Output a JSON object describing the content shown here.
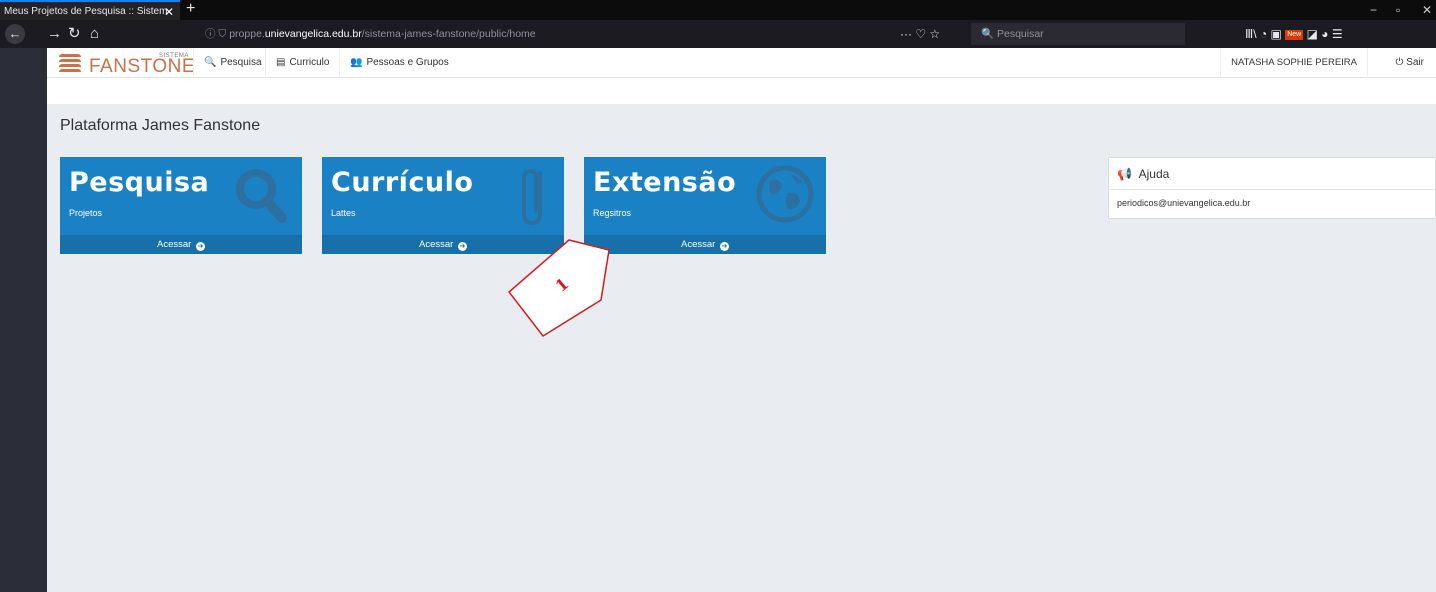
{
  "browser": {
    "tab_title": "Meus Projetos de Pesquisa :: Sistem",
    "tab_close": "✕",
    "new_tab": "+",
    "url_prefix": "ⓘ ⛉  proppe.",
    "url_host": "unievangelica.edu.br",
    "url_path": "/sistema-james-fanstone/public/home",
    "url_actions": "··· ♡ ☆",
    "search_placeholder": "🔍  Pesquisar",
    "toolbar_icons": "Ⅲ\\  ◔   ▣",
    "new_badge": "New",
    "window_minimize": "−",
    "window_restore": "▫",
    "window_close": "✕"
  },
  "header": {
    "logo_sup": "SISTEMA",
    "logo_text": "FANSTONE",
    "menu": [
      {
        "icon": "🔍",
        "label": "Pesquisa"
      },
      {
        "icon": "▤",
        "label": "Curriculo"
      },
      {
        "icon": "👥",
        "label": "Pessoas e Grupos"
      }
    ],
    "user_name": "NATASHA SOPHIE PEREIRA",
    "logout_icon": "⏻",
    "logout_label": "Sair"
  },
  "page_title": "Plataforma James Fanstone",
  "tiles": [
    {
      "title": "Pesquisa",
      "subtitle": "Projetos",
      "action": "Acessar",
      "icon": "search-icon"
    },
    {
      "title": "Currículo",
      "subtitle": "Lattes",
      "action": "Acessar",
      "icon": "paperclip-icon"
    },
    {
      "title": "Extensão",
      "subtitle": "Regsitros",
      "action": "Acessar",
      "icon": "globe-icon"
    }
  ],
  "help": {
    "icon": "megaphone-icon",
    "title": "Ajuda",
    "email": "periodicos@unievangelica.edu.br"
  },
  "annotation": {
    "number": "1"
  },
  "colors": {
    "tile": "#1a82c4",
    "tile_footer": "#1870ab",
    "logo": "#c9704c",
    "background": "#e9ecf1"
  }
}
